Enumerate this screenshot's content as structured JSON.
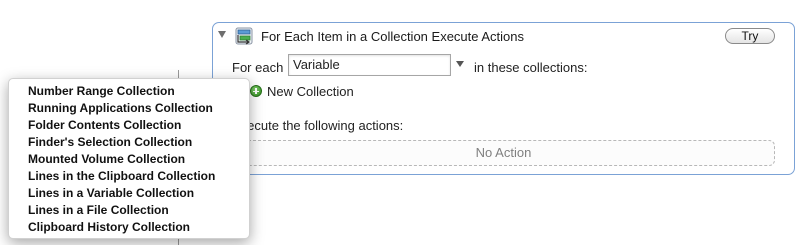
{
  "action": {
    "title": "For Each Item in a Collection Execute Actions",
    "try_label": "Try",
    "for_each_label": "For each",
    "variable_value": "Variable",
    "in_collections_label": "in these collections:",
    "new_collection_label": "New Collection",
    "execute_label": "Execute the following actions:",
    "no_action_label": "No Action"
  },
  "menu": {
    "items": [
      {
        "label": "Number Range Collection"
      },
      {
        "label": "Running Applications Collection"
      },
      {
        "label": "Folder Contents Collection"
      },
      {
        "label": "Finder's Selection Collection"
      },
      {
        "label": "Mounted Volume Collection"
      },
      {
        "label": "Lines in the Clipboard Collection"
      },
      {
        "label": "Lines in a Variable Collection"
      },
      {
        "label": "Lines in a File Collection"
      },
      {
        "label": "Clipboard History Collection"
      }
    ]
  },
  "colors": {
    "panel_border": "#7ba2d6",
    "plus_green": "#2f8a1e"
  },
  "icons": {
    "disclosure": "disclosure-triangle-icon",
    "action": "action-loop-icon",
    "add": "plus-icon",
    "dropdown": "dropdown-arrow-icon"
  }
}
